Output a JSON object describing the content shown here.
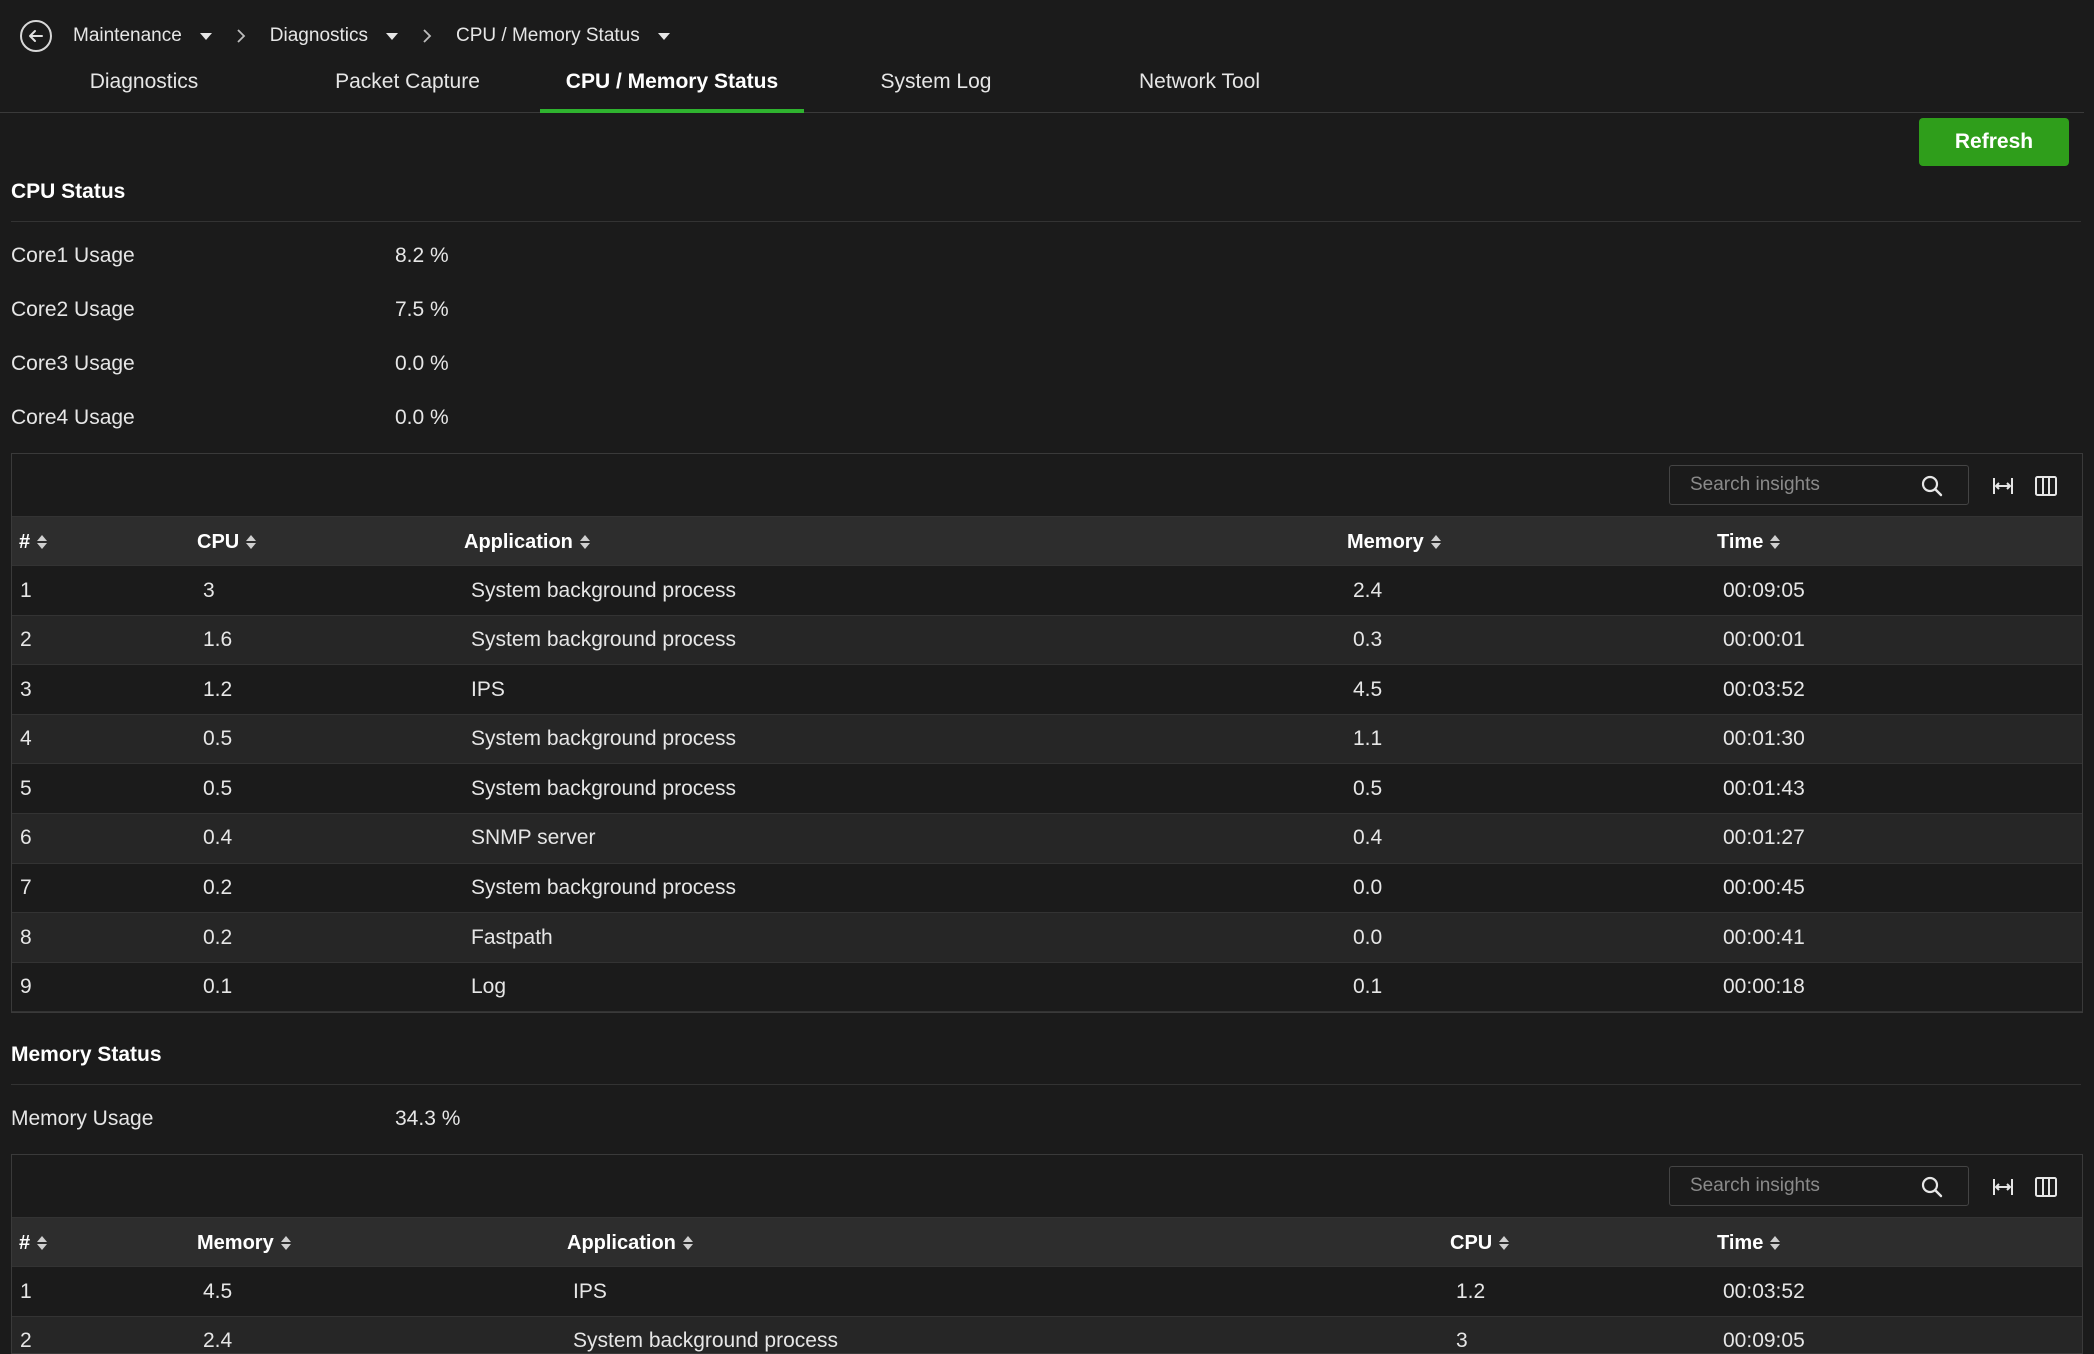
{
  "breadcrumb": {
    "items": [
      {
        "label": "Maintenance"
      },
      {
        "label": "Diagnostics"
      },
      {
        "label": "CPU / Memory Status"
      }
    ]
  },
  "tabs": [
    {
      "label": "Diagnostics"
    },
    {
      "label": "Packet Capture"
    },
    {
      "label": "CPU / Memory Status",
      "active": true
    },
    {
      "label": "System Log"
    },
    {
      "label": "Network Tool"
    }
  ],
  "refresh_label": "Refresh",
  "cpu_status": {
    "title": "CPU Status",
    "cores": [
      {
        "label": "Core1 Usage",
        "value": "8.2 %"
      },
      {
        "label": "Core2 Usage",
        "value": "7.5 %"
      },
      {
        "label": "Core3 Usage",
        "value": "0.0 %"
      },
      {
        "label": "Core4 Usage",
        "value": "0.0 %"
      }
    ]
  },
  "cpu_table": {
    "search_placeholder": "Search insights",
    "headers": [
      "#",
      "CPU",
      "Application",
      "Memory",
      "Time"
    ],
    "rows": [
      [
        "1",
        "3",
        "System background process",
        "2.4",
        "00:09:05"
      ],
      [
        "2",
        "1.6",
        "System background process",
        "0.3",
        "00:00:01"
      ],
      [
        "3",
        "1.2",
        "IPS",
        "4.5",
        "00:03:52"
      ],
      [
        "4",
        "0.5",
        "System background process",
        "1.1",
        "00:01:30"
      ],
      [
        "5",
        "0.5",
        "System background process",
        "0.5",
        "00:01:43"
      ],
      [
        "6",
        "0.4",
        "SNMP server",
        "0.4",
        "00:01:27"
      ],
      [
        "7",
        "0.2",
        "System background process",
        "0.0",
        "00:00:45"
      ],
      [
        "8",
        "0.2",
        "Fastpath",
        "0.0",
        "00:00:41"
      ],
      [
        "9",
        "0.1",
        "Log",
        "0.1",
        "00:00:18"
      ]
    ]
  },
  "memory_status": {
    "title": "Memory Status",
    "usage_label": "Memory Usage",
    "usage_value": "34.3 %"
  },
  "memory_table": {
    "search_placeholder": "Search insights",
    "headers": [
      "#",
      "Memory",
      "Application",
      "CPU",
      "Time"
    ],
    "rows": [
      [
        "1",
        "4.5",
        "IPS",
        "1.2",
        "00:03:52"
      ],
      [
        "2",
        "2.4",
        "System background process",
        "3",
        "00:09:05"
      ]
    ]
  },
  "colors": {
    "background": "#1b1b1b",
    "accent": "#2f9e1b",
    "tab_underline": "#2fb32f",
    "header_row": "#2d2d2d",
    "alt_row": "#262626"
  }
}
